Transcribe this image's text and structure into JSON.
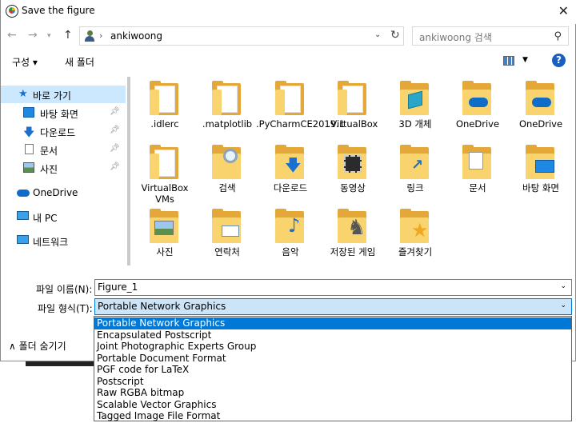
{
  "window": {
    "title": "Save the figure"
  },
  "nav": {
    "path_segment": "ankiwoong",
    "search_placeholder": "ankiwoong 검색"
  },
  "toolbar": {
    "organize_label": "구성 ▾",
    "new_folder_label": "새 폴더"
  },
  "sidebar": {
    "items": [
      {
        "label": "바로 가기",
        "icon": "star-icon",
        "pinned": false
      },
      {
        "label": "바탕 화면",
        "icon": "desktop-icon",
        "pinned": true
      },
      {
        "label": "다운로드",
        "icon": "download-icon",
        "pinned": true
      },
      {
        "label": "문서",
        "icon": "documents-icon",
        "pinned": true
      },
      {
        "label": "사진",
        "icon": "pictures-icon",
        "pinned": true
      },
      {
        "label": "OneDrive",
        "icon": "cloud-icon",
        "pinned": false
      },
      {
        "label": "내 PC",
        "icon": "pc-icon",
        "pinned": false
      },
      {
        "label": "네트워크",
        "icon": "network-icon",
        "pinned": false
      }
    ]
  },
  "files": [
    {
      "name": ".idlerc",
      "icon": "folder-icon"
    },
    {
      "name": ".matplotlib",
      "icon": "folder-icon"
    },
    {
      "name": ".PyCharmCE2019.1",
      "icon": "folder-icon"
    },
    {
      "name": ".VirtualBox",
      "icon": "folder-icon"
    },
    {
      "name": "3D 개체",
      "icon": "3d-objects-icon"
    },
    {
      "name": "OneDrive",
      "icon": "onedrive-folder-icon"
    },
    {
      "name": "OneDrive",
      "icon": "onedrive-folder-icon"
    },
    {
      "name": "VirtualBox VMs",
      "icon": "folder-icon"
    },
    {
      "name": "검색",
      "icon": "search-folder-icon"
    },
    {
      "name": "다운로드",
      "icon": "downloads-folder-icon"
    },
    {
      "name": "동영상",
      "icon": "videos-folder-icon"
    },
    {
      "name": "링크",
      "icon": "links-folder-icon"
    },
    {
      "name": "문서",
      "icon": "documents-folder-icon"
    },
    {
      "name": "바탕 화면",
      "icon": "desktop-folder-icon"
    },
    {
      "name": "사진",
      "icon": "pictures-folder-icon"
    },
    {
      "name": "연락처",
      "icon": "contacts-folder-icon"
    },
    {
      "name": "음악",
      "icon": "music-folder-icon"
    },
    {
      "name": "저장된 게임",
      "icon": "saved-games-folder-icon"
    },
    {
      "name": "즐겨찾기",
      "icon": "favorites-folder-icon"
    }
  ],
  "form": {
    "filename_label": "파일 이름(N):",
    "filename_value": "Figure_1",
    "filetype_label": "파일 형식(T):",
    "filetype_value": "Portable Network Graphics",
    "hide_folders_label": "폴더 숨기기"
  },
  "filetype_options": [
    "Portable Network Graphics",
    "Encapsulated Postscript",
    "Joint Photographic Experts Group",
    "Portable Document Format",
    "PGF code for LaTeX",
    "Postscript",
    "Raw RGBA bitmap",
    "Scalable Vector Graphics",
    "Tagged Image File Format"
  ],
  "colors": {
    "accent": "#0078d7",
    "selection": "#cce8ff",
    "folder": "#f8d36e"
  }
}
